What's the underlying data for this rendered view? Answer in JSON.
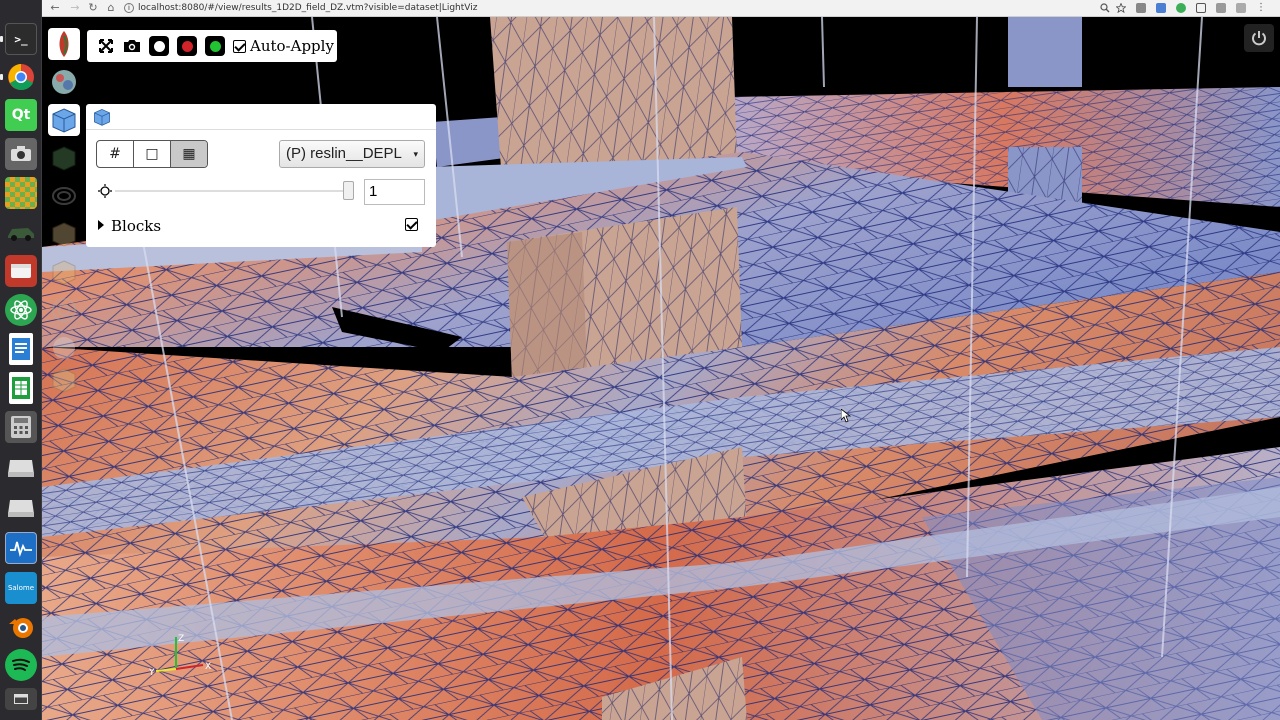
{
  "browser": {
    "url": "localhost:8080/#/view/results_1D2D_field_DZ.vtm?visible=dataset|LightViz",
    "nav": {
      "back": "←",
      "forward": "→",
      "reload": "↻",
      "home": "⌂"
    },
    "info_icon": "i"
  },
  "launcher": {
    "items": [
      "terminal-icon",
      "chrome-icon",
      "qt-icon",
      "camera-icon",
      "checker-icon",
      "car-icon",
      "files-icon",
      "atom-icon",
      "writer-icon",
      "calc-icon",
      "calculator-icon",
      "drive-icon",
      "drive-icon",
      "monitor-icon",
      "app-icon",
      "blender-icon",
      "spotify-icon",
      "bottom-icon"
    ]
  },
  "toolbar": {
    "auto_apply_label": "Auto-Apply",
    "auto_apply_checked": true,
    "colors": {
      "white": "#ffffff",
      "red": "#d0232a",
      "green": "#22c233"
    }
  },
  "panel": {
    "repr_buttons": [
      "#",
      "□",
      "▦"
    ],
    "color_by": "(P) reslin__DEPL",
    "caret": "▾",
    "opacity_value": "1",
    "opacity_level": 1.0,
    "blocks_label": "Blocks",
    "blocks_checked": true
  },
  "axes": {
    "z": "Z",
    "y": "Y",
    "x": "X"
  },
  "colors": {
    "mesh_warm": "#d88a68",
    "mesh_hot": "#d46a4a",
    "mesh_cool": "#8a96c8",
    "mesh_lines": "#1e2a7a",
    "pillar": "#c9a492"
  }
}
